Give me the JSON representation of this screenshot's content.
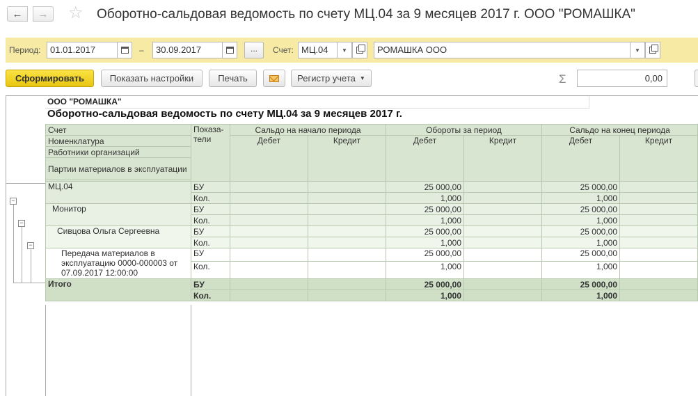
{
  "window": {
    "title": "Оборотно-сальдовая ведомость по счету МЦ.04 за 9 месяцев 2017 г. ООО \"РОМАШКА\"",
    "back_icon": "arrow-left-icon",
    "forward_icon": "arrow-right-icon",
    "favorite_icon": "star-icon"
  },
  "filters": {
    "period_label": "Период:",
    "date_from": "01.01.2017",
    "dash": "–",
    "date_to": "30.09.2017",
    "dots_label": "...",
    "account_label": "Счет:",
    "account_value": "МЦ.04",
    "org_value": "РОМАШКА ООО",
    "panel_color": "#f6eaa4"
  },
  "toolbar": {
    "generate_label": "Сформировать",
    "settings_label": "Показать настройки",
    "print_label": "Печать",
    "register_label": "Регистр учета",
    "sum_symbol": "Σ",
    "sum_value": "0,00",
    "accent_color": "#f4d82b"
  },
  "report": {
    "org": "ООО \"РОМАШКА\"",
    "title": "Оборотно-сальдовая ведомость по счету МЦ.04 за 9 месяцев 2017 г.",
    "header": {
      "row_labels": [
        "Счет",
        "Номенклатура",
        "Работники организаций",
        "Партии материалов в эксплуатации"
      ],
      "indicators": "Показа-\nтели",
      "opening": "Сальдо на начало периода",
      "turnover": "Обороты за период",
      "closing": "Сальдо на конец периода",
      "debit": "Дебет",
      "credit": "Кредит"
    },
    "rows": [
      {
        "level": 1,
        "name": "МЦ.04",
        "lines": [
          {
            "ind": "БУ",
            "op_d": "",
            "op_c": "",
            "tr_d": "25 000,00",
            "tr_c": "",
            "cl_d": "25 000,00",
            "cl_c": ""
          },
          {
            "ind": "Кол.",
            "op_d": "",
            "op_c": "",
            "tr_d": "1,000",
            "tr_c": "",
            "cl_d": "1,000",
            "cl_c": ""
          }
        ]
      },
      {
        "level": 2,
        "name": "Монитор",
        "lines": [
          {
            "ind": "БУ",
            "op_d": "",
            "op_c": "",
            "tr_d": "25 000,00",
            "tr_c": "",
            "cl_d": "25 000,00",
            "cl_c": ""
          },
          {
            "ind": "Кол.",
            "op_d": "",
            "op_c": "",
            "tr_d": "1,000",
            "tr_c": "",
            "cl_d": "1,000",
            "cl_c": ""
          }
        ]
      },
      {
        "level": 3,
        "name": "Сивцова Ольга Сергеевна",
        "lines": [
          {
            "ind": "БУ",
            "op_d": "",
            "op_c": "",
            "tr_d": "25 000,00",
            "tr_c": "",
            "cl_d": "25 000,00",
            "cl_c": ""
          },
          {
            "ind": "Кол.",
            "op_d": "",
            "op_c": "",
            "tr_d": "1,000",
            "tr_c": "",
            "cl_d": "1,000",
            "cl_c": ""
          }
        ]
      },
      {
        "level": 4,
        "name": "Передача материалов в эксплуатацию 0000-000003 от 07.09.2017 12:00:00",
        "lines": [
          {
            "ind": "БУ",
            "op_d": "",
            "op_c": "",
            "tr_d": "25 000,00",
            "tr_c": "",
            "cl_d": "25 000,00",
            "cl_c": ""
          },
          {
            "ind": "Кол.",
            "op_d": "",
            "op_c": "",
            "tr_d": "1,000",
            "tr_c": "",
            "cl_d": "1,000",
            "cl_c": ""
          }
        ]
      }
    ],
    "total": {
      "name": "Итого",
      "lines": [
        {
          "ind": "БУ",
          "op_d": "",
          "op_c": "",
          "tr_d": "25 000,00",
          "tr_c": "",
          "cl_d": "25 000,00",
          "cl_c": ""
        },
        {
          "ind": "Кол.",
          "op_d": "",
          "op_c": "",
          "tr_d": "1,000",
          "tr_c": "",
          "cl_d": "1,000",
          "cl_c": ""
        }
      ]
    }
  }
}
